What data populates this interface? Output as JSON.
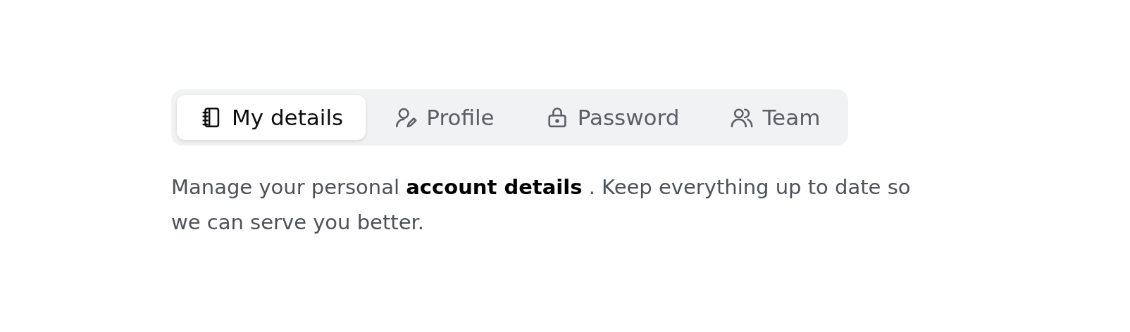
{
  "tabs": [
    {
      "label": "My details",
      "kind": "notebook",
      "selected": true
    },
    {
      "label": "Profile",
      "kind": "profile",
      "selected": false
    },
    {
      "label": "Password",
      "kind": "password",
      "selected": false
    },
    {
      "label": "Team",
      "kind": "team",
      "selected": false
    }
  ],
  "description": "Manage your personal **account details** . Keep everything up to date so we can serve you better."
}
